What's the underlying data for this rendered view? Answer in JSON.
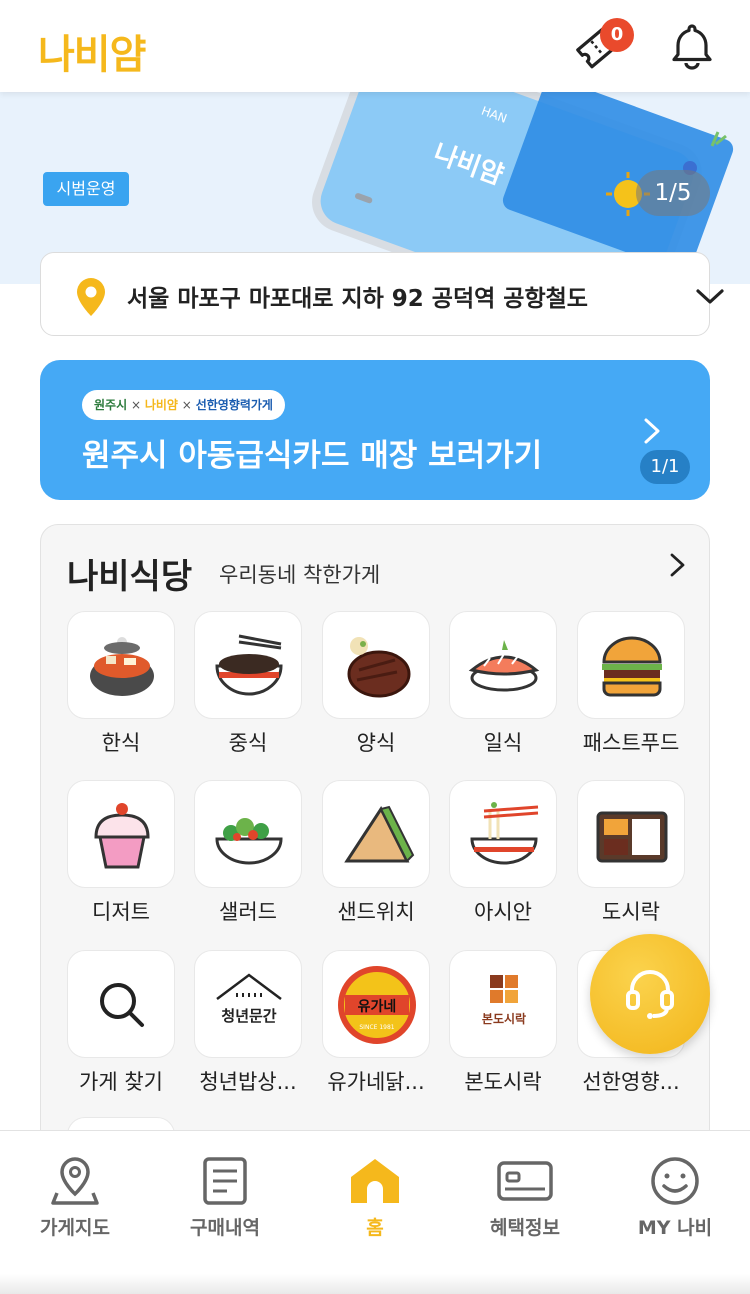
{
  "header": {
    "logo": "나비얌",
    "coupon_count": "0"
  },
  "hero": {
    "pill": "시범운영",
    "counter": "1/5",
    "phone_text": "나비얌",
    "phone_top": "HAN"
  },
  "address": {
    "text": "서울 마포구 마포대로 지하 92 공덕역 공항철도"
  },
  "promo": {
    "chip_city": "원주시",
    "chip_x": "×",
    "chip_brand": "나비얌",
    "chip_partner": "선한영향력가게",
    "title": "원주시 아동급식카드 매장 보러가기",
    "counter": "1/1"
  },
  "section": {
    "title": "나비식당",
    "subtitle": "우리동네 착한가게",
    "categories": [
      {
        "label": "한식",
        "icon": "korean-stew-icon"
      },
      {
        "label": "중식",
        "icon": "noodle-bowl-icon"
      },
      {
        "label": "양식",
        "icon": "steak-icon"
      },
      {
        "label": "일식",
        "icon": "sushi-icon"
      },
      {
        "label": "패스트푸드",
        "icon": "burger-icon"
      },
      {
        "label": "디저트",
        "icon": "cupcake-icon"
      },
      {
        "label": "샐러드",
        "icon": "salad-icon"
      },
      {
        "label": "샌드위치",
        "icon": "sandwich-icon"
      },
      {
        "label": "아시안",
        "icon": "asian-noodle-icon"
      },
      {
        "label": "도시락",
        "icon": "lunchbox-icon"
      },
      {
        "label": "가게 찾기",
        "icon": "search-icon"
      },
      {
        "label": "청년밥상...",
        "icon": "youth-brand-logo"
      },
      {
        "label": "유가네닭...",
        "icon": "yoogane-logo"
      },
      {
        "label": "본도시락",
        "icon": "bondosirak-logo"
      },
      {
        "label": "선한영향...",
        "icon": "partner-logo"
      }
    ],
    "logo_texts": {
      "youth": "청년문간",
      "yoogane": "유가네",
      "yoogane_since": "SINCE 1981",
      "bon": "본도시락"
    }
  },
  "bottom_nav": [
    {
      "label": "가게지도",
      "icon": "map-pin-icon",
      "active": false
    },
    {
      "label": "구매내역",
      "icon": "receipt-icon",
      "active": false
    },
    {
      "label": "홈",
      "icon": "home-icon",
      "active": true
    },
    {
      "label": "혜택정보",
      "icon": "card-icon",
      "active": false
    },
    {
      "label": "MY 나비",
      "icon": "smile-icon",
      "active": false
    }
  ],
  "colors": {
    "brand": "#f5b81c",
    "promo_blue": "#45a9f5",
    "badge_red": "#e94a2c"
  }
}
